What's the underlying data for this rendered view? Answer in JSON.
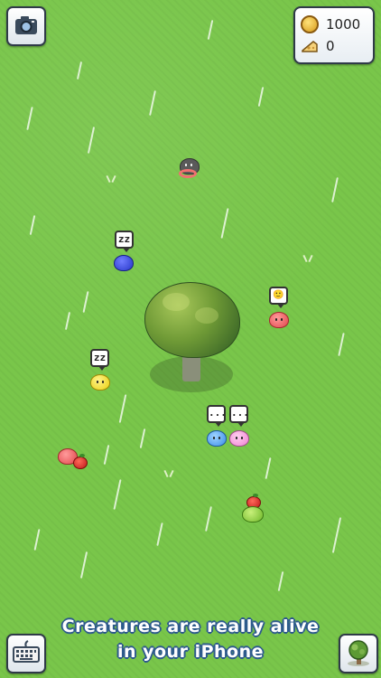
{
  "hud": {
    "coins": "1000",
    "cheese": "0"
  },
  "creatures": [
    {
      "name": "blue-creature",
      "speech": "zz"
    },
    {
      "name": "yellow-creature",
      "speech": "zz"
    },
    {
      "name": "red-creature",
      "speech": "🙂"
    },
    {
      "name": "blue-creature-2",
      "speech": "..."
    },
    {
      "name": "pink-creature",
      "speech": "..."
    }
  ],
  "caption": {
    "line1": "Creatures are really alive",
    "line2": "in your iPhone"
  },
  "icons": {
    "camera": "camera-icon",
    "keyboard": "keyboard-icon",
    "tree": "tree-icon",
    "coin": "coin-icon",
    "cheese": "cheese-icon"
  }
}
